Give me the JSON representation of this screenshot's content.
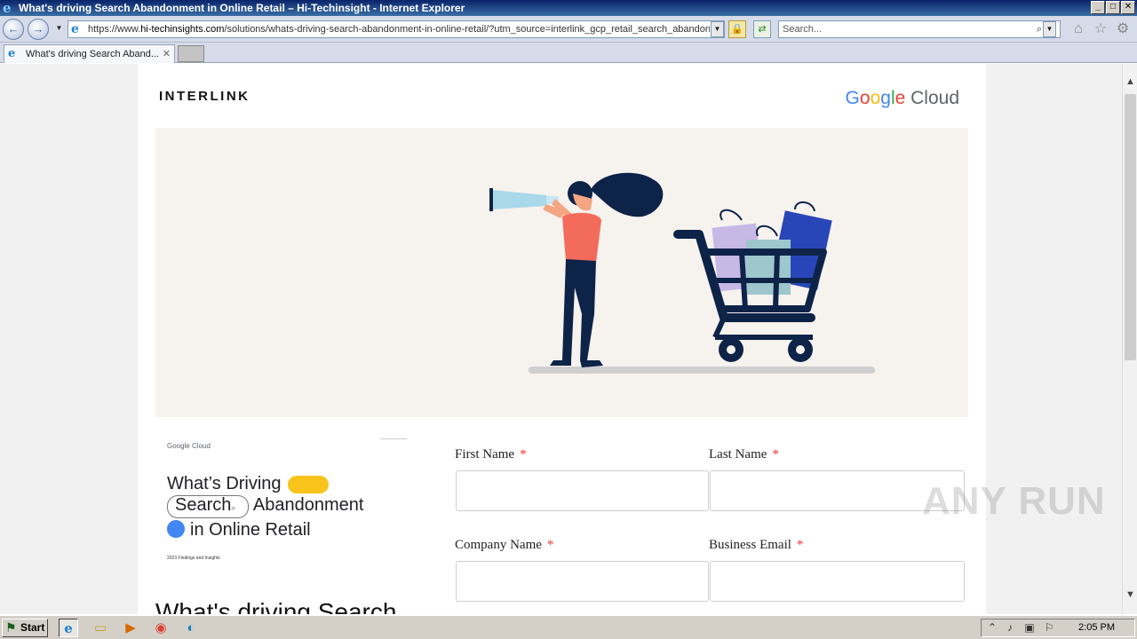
{
  "window": {
    "title": "What's driving Search Abandonment in Online Retail – Hi-Techinsight - Internet Explorer",
    "min_label": "_",
    "max_label": "□",
    "close_label": "✕"
  },
  "nav": {
    "back_glyph": "←",
    "forward_glyph": "→",
    "url_prefix": "https://www.",
    "url_host": "hi-techinsights.com",
    "url_path": "/solutions/whats-driving-search-abandonment-in-online-retail/?utm_source=interlink_gcp_retail_search_abandon",
    "search_placeholder": "Search...",
    "search_glyph": "⌕",
    "lock_glyph": "🔒",
    "refresh_glyph": "⇄",
    "home_glyph": "⌂",
    "favorites_glyph": "☆",
    "tools_glyph": "⚙"
  },
  "tabs": [
    {
      "label": "What's driving Search Aband...",
      "close": "✕"
    }
  ],
  "page": {
    "brand": "INTERLINK",
    "gcloud": {
      "letters": [
        "G",
        "o",
        "o",
        "g",
        "l",
        "e"
      ],
      "colors": [
        "#4285F4",
        "#EA4335",
        "#FBBC05",
        "#4285F4",
        "#34A853",
        "#EA4335"
      ],
      "cloud": " Cloud"
    },
    "ebook": {
      "brand": "Google Cloud",
      "line1": "What’s Driving",
      "line2_pill": "Search",
      "line2_rest": "Abandonment",
      "line3": "in Online Retail",
      "footer": "2023 Findings and Insights"
    },
    "heading": "What's driving Search",
    "form": {
      "first_name": "First Name",
      "last_name": "Last Name",
      "company_name": "Company Name",
      "business_email": "Business Email",
      "required_mark": "*"
    }
  },
  "watermark": "ANY RUN",
  "taskbar": {
    "start_label": "Start",
    "clock": "2:05 PM"
  },
  "colors": {
    "hero_bg": "#f6f2ee",
    "navy": "#0d2348",
    "coral": "#f26b5b",
    "required": "#e33333"
  }
}
